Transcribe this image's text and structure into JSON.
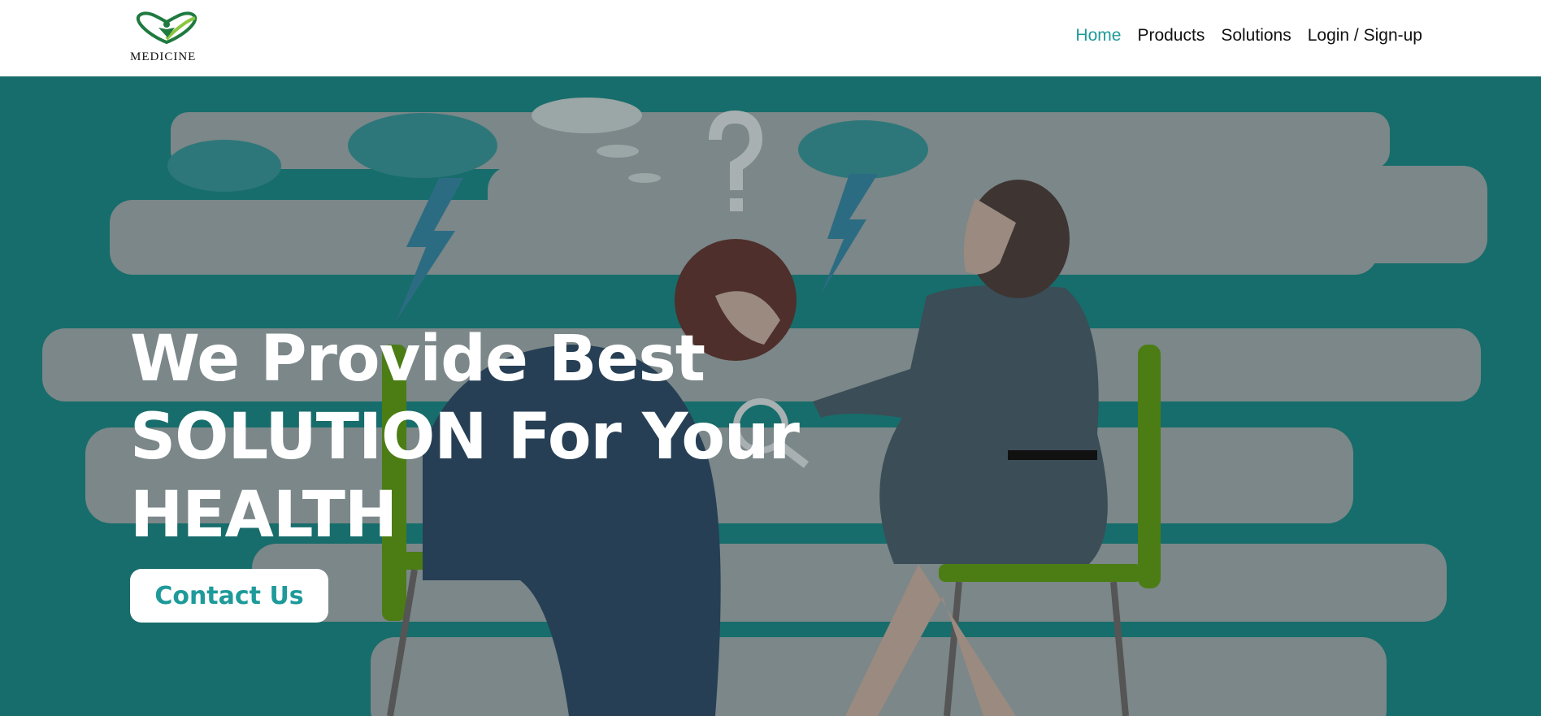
{
  "brand": {
    "logo_text": "MEDICINE",
    "accent": "#1f9a9a",
    "hero_bg": "#176d6b"
  },
  "nav": {
    "items": [
      {
        "label": "Home",
        "active": true
      },
      {
        "label": "Products"
      },
      {
        "label": "Solutions"
      },
      {
        "label": "Login / Sign-up"
      }
    ]
  },
  "hero": {
    "headline_lines": [
      "We Provide Best",
      "SOLUTION For Your",
      "HEALTH"
    ],
    "cta_label": "Contact Us",
    "illustration": "therapy-session-illustration"
  }
}
